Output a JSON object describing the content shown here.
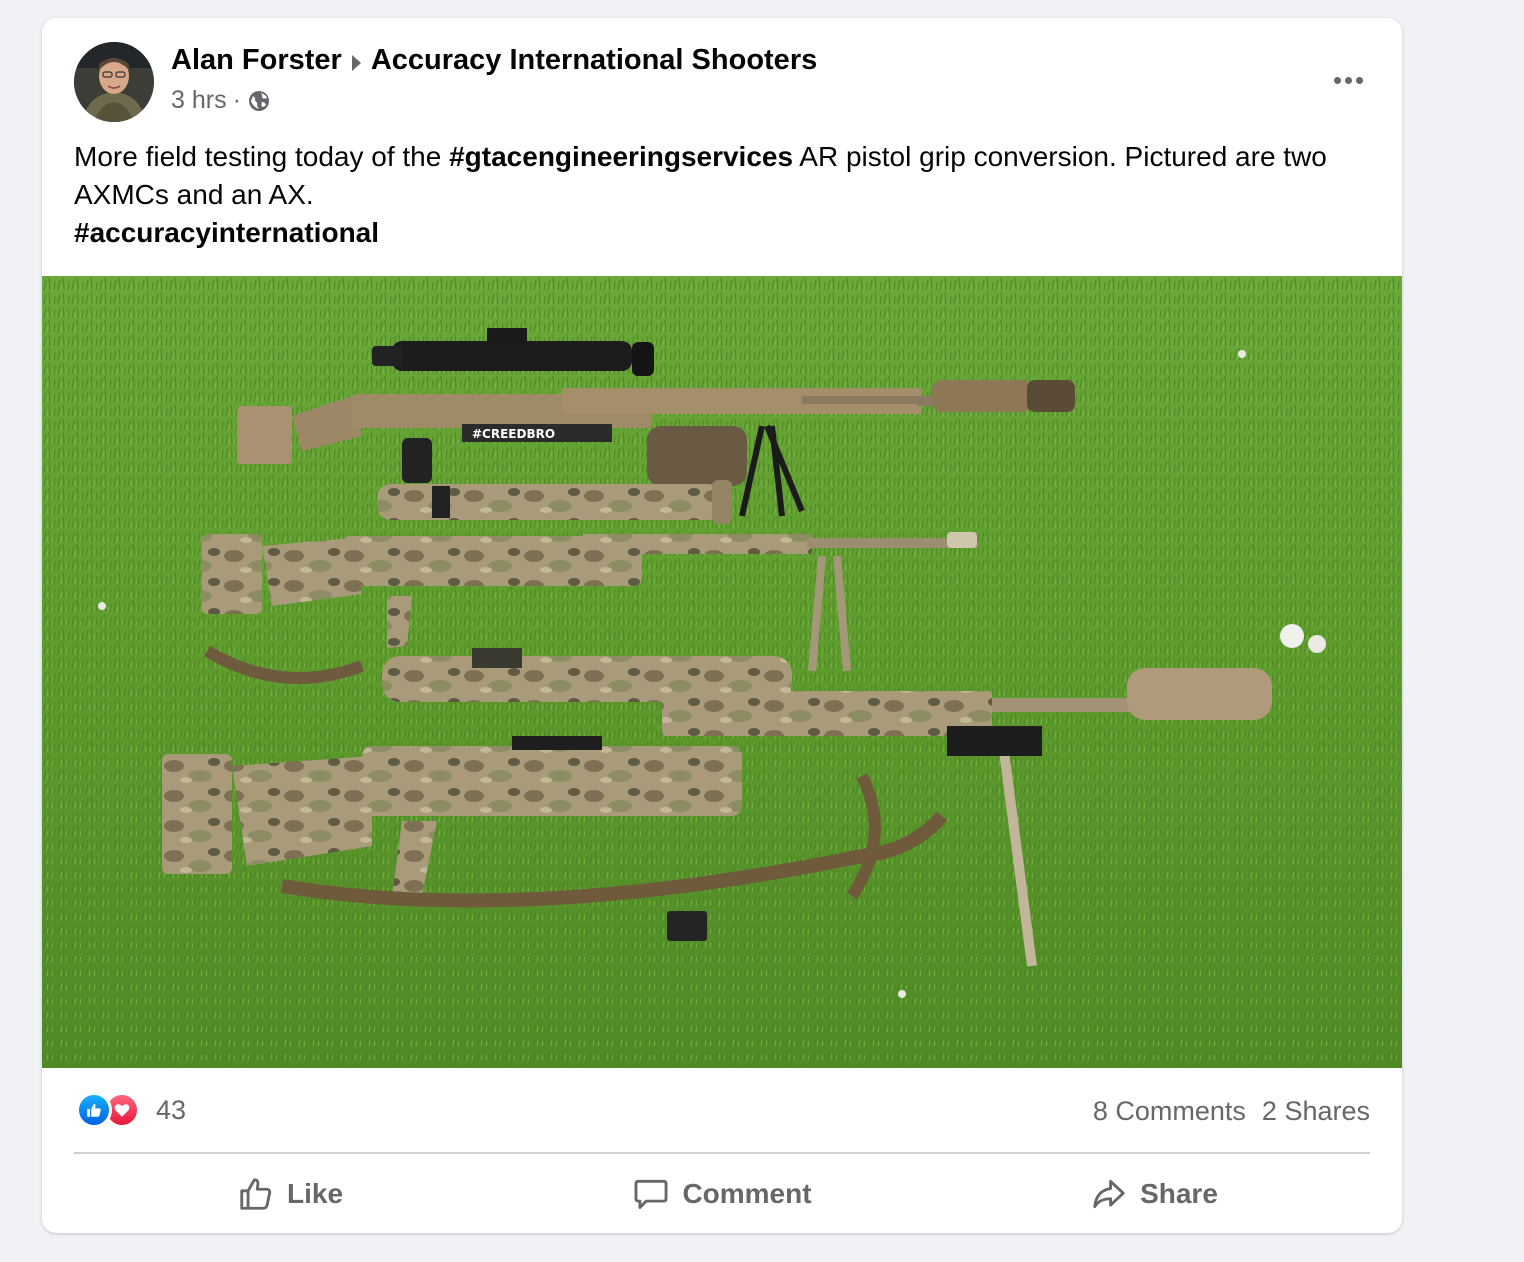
{
  "post": {
    "author": "Alan Forster",
    "group": "Accuracy International Shooters",
    "time": "3 hrs",
    "separator": "·",
    "text": {
      "part1": "More field testing today of the ",
      "hashtag1": "#gtacengineeringservices",
      "part2": " AR pistol grip conversion. Pictured are two AXMCs and an AX.",
      "hashtag2": "#accuracyinternational"
    },
    "photo_label": "#CREEDBRO"
  },
  "stats": {
    "reaction_count": "43",
    "comments": "8 Comments",
    "shares": "2 Shares"
  },
  "actions": {
    "like": "Like",
    "comment": "Comment",
    "share": "Share"
  },
  "icons": {
    "privacy": "globe-icon",
    "more": "more-horizontal-icon",
    "like": "thumbs-up-icon",
    "love": "heart-icon",
    "comment": "speech-bubble-icon",
    "share": "share-arrow-icon"
  },
  "colors": {
    "background": "#f0f2f5",
    "card": "#ffffff",
    "secondary_text": "#65676b",
    "like_blue": "#0062df",
    "love_red": "#e61739",
    "grass": "#5f9c2e"
  }
}
